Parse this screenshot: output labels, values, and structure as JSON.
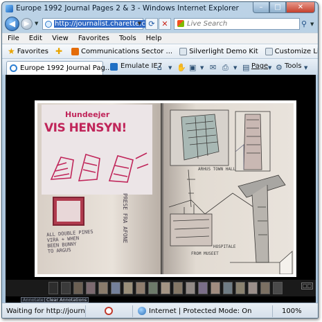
{
  "window": {
    "title": "Europe 1992 Journal Pages 2 & 3 - Windows Internet Explorer",
    "minimize_glyph": "–",
    "maximize_glyph": "□",
    "close_glyph": "✕"
  },
  "address_bar": {
    "url": "http://journalist.charette.com",
    "back_glyph": "◀",
    "forward_glyph": "▶",
    "refresh_glyph": "⟳",
    "stop_glyph": "✕"
  },
  "search": {
    "placeholder": "Live Search",
    "go_glyph": "⚲"
  },
  "menu": {
    "items": [
      "File",
      "Edit",
      "View",
      "Favorites",
      "Tools",
      "Help"
    ]
  },
  "favorites_bar": {
    "favorites_label": "Favorites",
    "links": [
      "Communications Sector ...",
      "Silverlight Demo Kit",
      "Customize Links"
    ]
  },
  "tab": {
    "label": "Europe 1992 Journal Pag..."
  },
  "command_bar": {
    "emulate_label": "Emulate IE7",
    "page_label": "Page",
    "tools_label": "Tools"
  },
  "journal": {
    "poster_title": "Hundeejer",
    "poster_headline": "VIS HENSYN!",
    "note_left": "ALL DOUBLE PINES\nVIRA + WHEN\nBEEN BUNNY\nTO ARGUS",
    "vertical_note": "PRESE FRA AFONE",
    "right_caption_top": "ARHUS TOWN HALL",
    "right_caption_bottom": "FROM MUSEET",
    "right_caption_bottom2": "HOSPITALE"
  },
  "viewer": {
    "annotate_label": "Annotate",
    "clear_annotations_label": "Clear Annotations",
    "page_indicator": "□□"
  },
  "status_bar": {
    "status_text": "Waiting for http://journ",
    "zone_text": "Internet | Protected Mode: On",
    "zoom_text": "100%"
  },
  "colors": {
    "poster_red": "#c0255a",
    "url_highlight": "#316ac5",
    "viewer_background": "#000000"
  }
}
